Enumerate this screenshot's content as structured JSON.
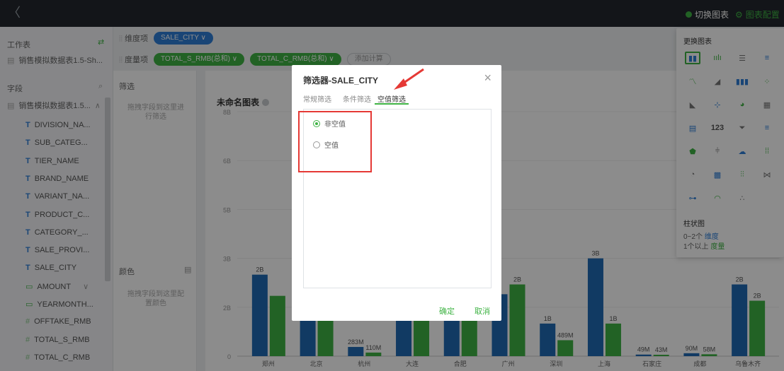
{
  "topbar": {
    "back_label": "〈",
    "switch_chart_label": "切换图表",
    "chart_config_label": "图表配置"
  },
  "leftpanel": {
    "worksheet_label": "工作表",
    "dataset_name": "销售模拟数据表1.5-Sh...",
    "fields_label": "字段",
    "table_name": "销售模拟数据表1.5...",
    "fields": [
      {
        "type": "T",
        "name": "DIVISION_NA..."
      },
      {
        "type": "T",
        "name": "SUB_CATEG..."
      },
      {
        "type": "T",
        "name": "TIER_NAME"
      },
      {
        "type": "T",
        "name": "BRAND_NAME"
      },
      {
        "type": "T",
        "name": "VARIANT_NA..."
      },
      {
        "type": "T",
        "name": "PRODUCT_C..."
      },
      {
        "type": "T",
        "name": "CATEGORY_..."
      },
      {
        "type": "T",
        "name": "SALE_PROVI..."
      },
      {
        "type": "T",
        "name": "SALE_CITY"
      },
      {
        "type": "date",
        "name": "AMOUNT"
      },
      {
        "type": "date",
        "name": "YEARMONTH..."
      },
      {
        "type": "num",
        "name": "OFFTAKE_RMB"
      },
      {
        "type": "num",
        "name": "TOTAL_S_RMB"
      },
      {
        "type": "num",
        "name": "TOTAL_C_RMB"
      }
    ]
  },
  "toolbar": {
    "dimension_label": "维度项",
    "dimension_pill": "SALE_CITY ∨",
    "measure_label": "度量项",
    "measure_pill_1": "TOTAL_S_RMB(总和) ∨",
    "measure_pill_2": "TOTAL_C_RMB(总和) ∨",
    "add_calc": "添加计算"
  },
  "midpanel": {
    "filter_label": "筛选",
    "filter_hint": "拖拽字段到这里进行筛选",
    "color_label": "颜色",
    "color_hint": "拖拽字段到这里配置颜色"
  },
  "chart": {
    "title": "未命名图表"
  },
  "chart_data": {
    "type": "bar",
    "categories": [
      "郑州",
      "北京",
      "杭州",
      "大连",
      "合肥",
      "广州",
      "深圳",
      "上海",
      "石家庄",
      "成都",
      "乌鲁木齐"
    ],
    "series": [
      {
        "name": "TOTAL_S_RMB",
        "color": "#1f6ab5",
        "values": [
          2.5,
          2.4,
          0.283,
          2.6,
          2.6,
          1.9,
          1.0,
          3.0,
          0.049,
          0.09,
          2.2
        ]
      },
      {
        "name": "TOTAL_C_RMB",
        "color": "#3fb344",
        "values": [
          1.85,
          1.8,
          0.11,
          2.1,
          1.95,
          2.2,
          0.489,
          1.0,
          0.043,
          0.058,
          1.7
        ]
      }
    ],
    "labels_s": [
      "2B",
      "",
      "283M",
      "",
      "",
      "",
      "1B",
      "3B",
      "49M",
      "90M",
      "2B"
    ],
    "labels_c": [
      "",
      "2B",
      "110M",
      "",
      "",
      "2B",
      "489M",
      "1B",
      "43M",
      "58M",
      "2B"
    ],
    "yticks": [
      "0",
      "2B",
      "3B",
      "5B",
      "6B",
      "8B"
    ],
    "ytick_values": [
      0,
      1.5,
      3.0,
      4.5,
      6.0,
      7.5
    ],
    "ylim": [
      0,
      7.5
    ]
  },
  "popover": {
    "title": "更换图表",
    "icons": [
      "bar-chart",
      "grouped-bar",
      "horizontal-bar",
      "stacked-horizontal-bar",
      "line-chart",
      "area-chart",
      "stacked-bar",
      "scatter-chart",
      "map",
      "point-map",
      "pie-chart",
      "table",
      "heatmap",
      "kpi-number",
      "funnel",
      "ranked-bar",
      "radar",
      "bullet",
      "word-cloud",
      "matrix",
      "rose",
      "treemap",
      "boxplot",
      "sankey",
      "tree",
      "gauge",
      "bubble"
    ],
    "kpi_text": "123",
    "chart_name": "柱状图",
    "req_dim_prefix": "0~2个",
    "req_dim_word": "维度",
    "req_mea_prefix": "1个以上",
    "req_mea_word": "度量"
  },
  "dialog": {
    "title": "筛选器-SALE_CITY",
    "tabs": [
      "常规筛选",
      "条件筛选",
      "空值筛选"
    ],
    "options": [
      "非空值",
      "空值"
    ],
    "selected_index": 0,
    "confirm": "确定",
    "cancel": "取消"
  }
}
